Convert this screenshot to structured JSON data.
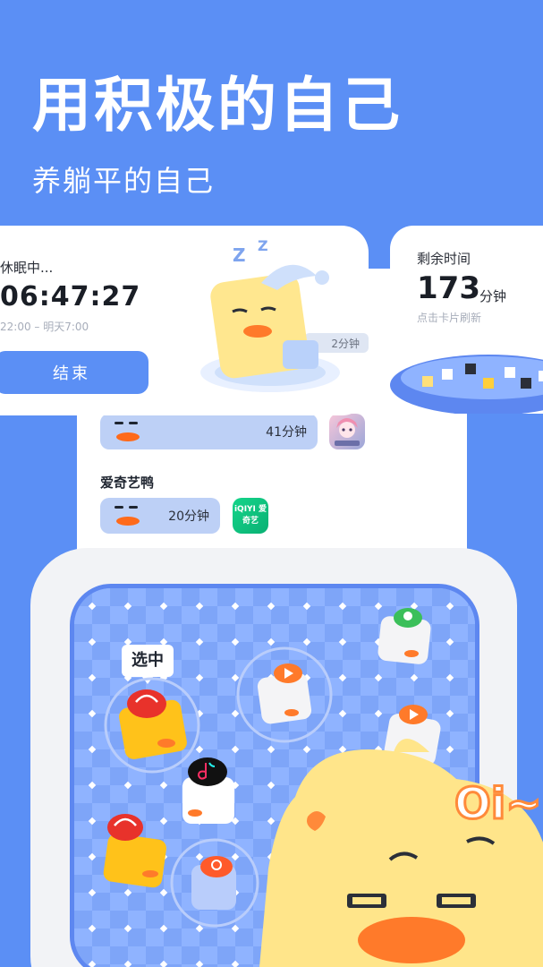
{
  "hero": {
    "title": "用积极的自己",
    "subtitle": "养躺平的自己"
  },
  "sleep_card": {
    "status": "休眠中...",
    "clock": "06:47:27",
    "range": "22:00 – 明天7:00",
    "end_button": "结束",
    "zzz": "Z Z",
    "peek_time": "2分钟"
  },
  "remain_card": {
    "title": "剩余时间",
    "value": "173",
    "unit": "分钟",
    "hint": "点击卡片刷新"
  },
  "list": {
    "rows": [
      {
        "time": "41分钟",
        "icon": "anime-game-icon"
      },
      {
        "label": "爱奇艺鸭",
        "time": "20分钟",
        "icon": "iqiyi-icon",
        "icon_text": "iQIYI 爱奇艺"
      }
    ]
  },
  "pool": {
    "select_label": "选中",
    "ducks": [
      "xiaohongshu",
      "tiktok",
      "tencent-video",
      "xiaohongshu",
      "kuaishou",
      "tencent-video",
      "game"
    ]
  },
  "mascot": {
    "exclaim": "Oi~"
  },
  "colors": {
    "background": "#5b8ff5",
    "accent": "#5b8ff5",
    "beak": "#ff6a1a",
    "duck_yellow": "#ffe58a"
  }
}
